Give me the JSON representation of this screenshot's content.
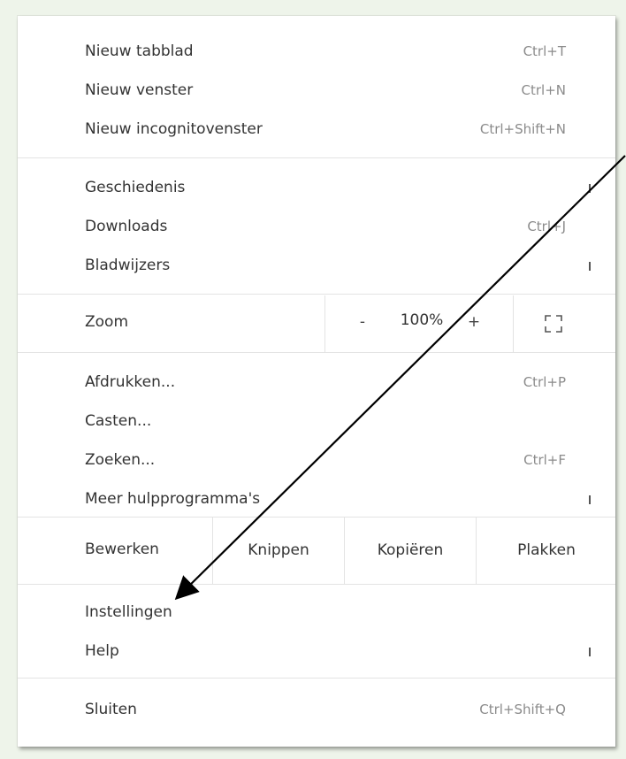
{
  "menu": {
    "new_tab": {
      "label": "Nieuw tabblad",
      "shortcut": "Ctrl+T"
    },
    "new_window": {
      "label": "Nieuw venster",
      "shortcut": "Ctrl+N"
    },
    "new_incognito": {
      "label": "Nieuw incognitovenster",
      "shortcut": "Ctrl+Shift+N"
    },
    "history": {
      "label": "Geschiedenis"
    },
    "downloads": {
      "label": "Downloads",
      "shortcut": "Ctrl+J"
    },
    "bookmarks": {
      "label": "Bladwijzers"
    },
    "zoom": {
      "label": "Zoom",
      "minus": "-",
      "value": "100%",
      "plus": "+",
      "fullscreen_icon": "fullscreen-icon"
    },
    "print": {
      "label": "Afdrukken...",
      "shortcut": "Ctrl+P"
    },
    "cast": {
      "label": "Casten..."
    },
    "find": {
      "label": "Zoeken...",
      "shortcut": "Ctrl+F"
    },
    "more_tools": {
      "label": "Meer hulpprogramma's"
    },
    "edit": {
      "label": "Bewerken",
      "cut": "Knippen",
      "copy": "Kopiëren",
      "paste": "Plakken"
    },
    "settings": {
      "label": "Instellingen"
    },
    "help": {
      "label": "Help"
    },
    "exit": {
      "label": "Sluiten",
      "shortcut": "Ctrl+Shift+Q"
    }
  },
  "colors": {
    "background": "#eef4ea",
    "panel": "#ffffff",
    "text": "#333333",
    "shortcut": "#8b8b8b",
    "separator": "#e3e3e3",
    "annotation_arrow": "#000000"
  }
}
